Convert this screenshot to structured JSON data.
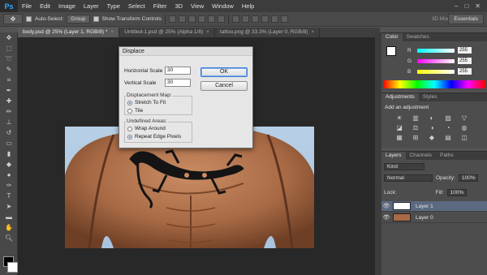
{
  "app": {
    "logo": "Ps"
  },
  "menu": [
    "File",
    "Edit",
    "Image",
    "Layer",
    "Type",
    "Select",
    "Filter",
    "3D",
    "View",
    "Window",
    "Help"
  ],
  "window_controls": [
    "–",
    "□",
    "✕"
  ],
  "options": {
    "auto_select_label": "Auto-Select:",
    "auto_select_value": "Group",
    "transform_label": "Show Transform Controls",
    "mode_3d": "3D Mode:",
    "workspace": "Essentials"
  },
  "tabs": [
    {
      "label": "body.psd @ 25% (Layer 1, RGB/8) *",
      "active": true
    },
    {
      "label": "Untitled-1.psd @ 25% (Alpha 1/8)",
      "active": false
    },
    {
      "label": "tattoo.png @ 33.3% (Layer 0, RGB/8)",
      "active": false
    }
  ],
  "dialog": {
    "title": "Displace",
    "horizontal_label": "Horizontal Scale",
    "horizontal_value": "30",
    "vertical_label": "Vertical Scale",
    "vertical_value": "30",
    "ok": "OK",
    "cancel": "Cancel",
    "map_legend": "Displacement Map:",
    "map_options": [
      "Stretch To Fit",
      "Tile"
    ],
    "map_selected": 0,
    "undef_legend": "Undefined Areas:",
    "undef_options": [
      "Wrap Around",
      "Repeat Edge Pixels"
    ],
    "undef_selected": 1
  },
  "color_panel": {
    "tabs": [
      "Color",
      "Swatches"
    ],
    "channels": [
      {
        "label": "R",
        "value": "255",
        "gradient": "linear-gradient(90deg,#00ffff,#ffffff)"
      },
      {
        "label": "G",
        "value": "255",
        "gradient": "linear-gradient(90deg,#ff00ff,#ffffff)"
      },
      {
        "label": "B",
        "value": "255",
        "gradient": "linear-gradient(90deg,#ffff00,#ffffff)"
      }
    ]
  },
  "adjustments_panel": {
    "tabs": [
      "Adjustments",
      "Styles"
    ],
    "title": "Add an adjustment",
    "icons": [
      "☀",
      "▥",
      "◐",
      "▨",
      "▽",
      "◪",
      "⚖",
      "◑",
      "◔",
      "◍",
      "▦",
      "⊞",
      "◆",
      "▤",
      "◫"
    ]
  },
  "layers_panel": {
    "tabs": [
      "Layers",
      "Channels",
      "Paths"
    ],
    "kind": "Kind",
    "blend_mode": "Normal",
    "opacity_label": "Opacity:",
    "opacity_value": "100%",
    "lock_label": "Lock:",
    "fill_label": "Fill:",
    "fill_value": "100%",
    "layers": [
      {
        "name": "Layer 1",
        "selected": true
      },
      {
        "name": "Layer 0",
        "selected": false
      }
    ]
  }
}
